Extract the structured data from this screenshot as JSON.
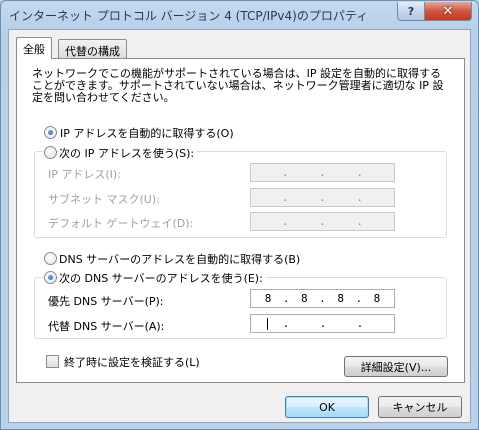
{
  "window": {
    "title": "インターネット プロトコル バージョン 4 (TCP/IPv4)のプロパティ",
    "help_glyph": "?",
    "close_glyph": "✕"
  },
  "tabs": [
    {
      "label": "全般",
      "active": true
    },
    {
      "label": "代替の構成",
      "active": false
    }
  ],
  "intro_text": "ネットワークでこの機能がサポートされている場合は、IP 設定を自動的に取得することができます。サポートされていない場合は、ネットワーク管理者に適切な IP 設定を問い合わせてください。",
  "ip": {
    "auto_label": "IP アドレスを自動的に取得する(O)",
    "auto_selected": true,
    "manual_label": "次の IP アドレスを使う(S):",
    "manual_selected": false,
    "fields": [
      {
        "label": "IP アドレス(I):",
        "value": [
          "",
          "",
          "",
          ""
        ]
      },
      {
        "label": "サブネット マスク(U):",
        "value": [
          "",
          "",
          "",
          ""
        ]
      },
      {
        "label": "デフォルト ゲートウェイ(D):",
        "value": [
          "",
          "",
          "",
          ""
        ]
      }
    ]
  },
  "dns": {
    "auto_label": "DNS サーバーのアドレスを自動的に取得する(B)",
    "auto_selected": false,
    "manual_label": "次の DNS サーバーのアドレスを使う(E):",
    "manual_selected": true,
    "preferred_label": "優先 DNS サーバー(P):",
    "preferred_octets": [
      "8",
      "8",
      "8",
      "8"
    ],
    "alternate_label": "代替 DNS サーバー(A):",
    "alternate_octets": [
      "",
      "",
      "",
      ""
    ]
  },
  "validate_label": "終了時に設定を検証する(L)",
  "validate_checked": false,
  "buttons": {
    "advanced": "詳細設定(V)...",
    "ok": "OK",
    "cancel": "キャンセル"
  },
  "dot": "."
}
